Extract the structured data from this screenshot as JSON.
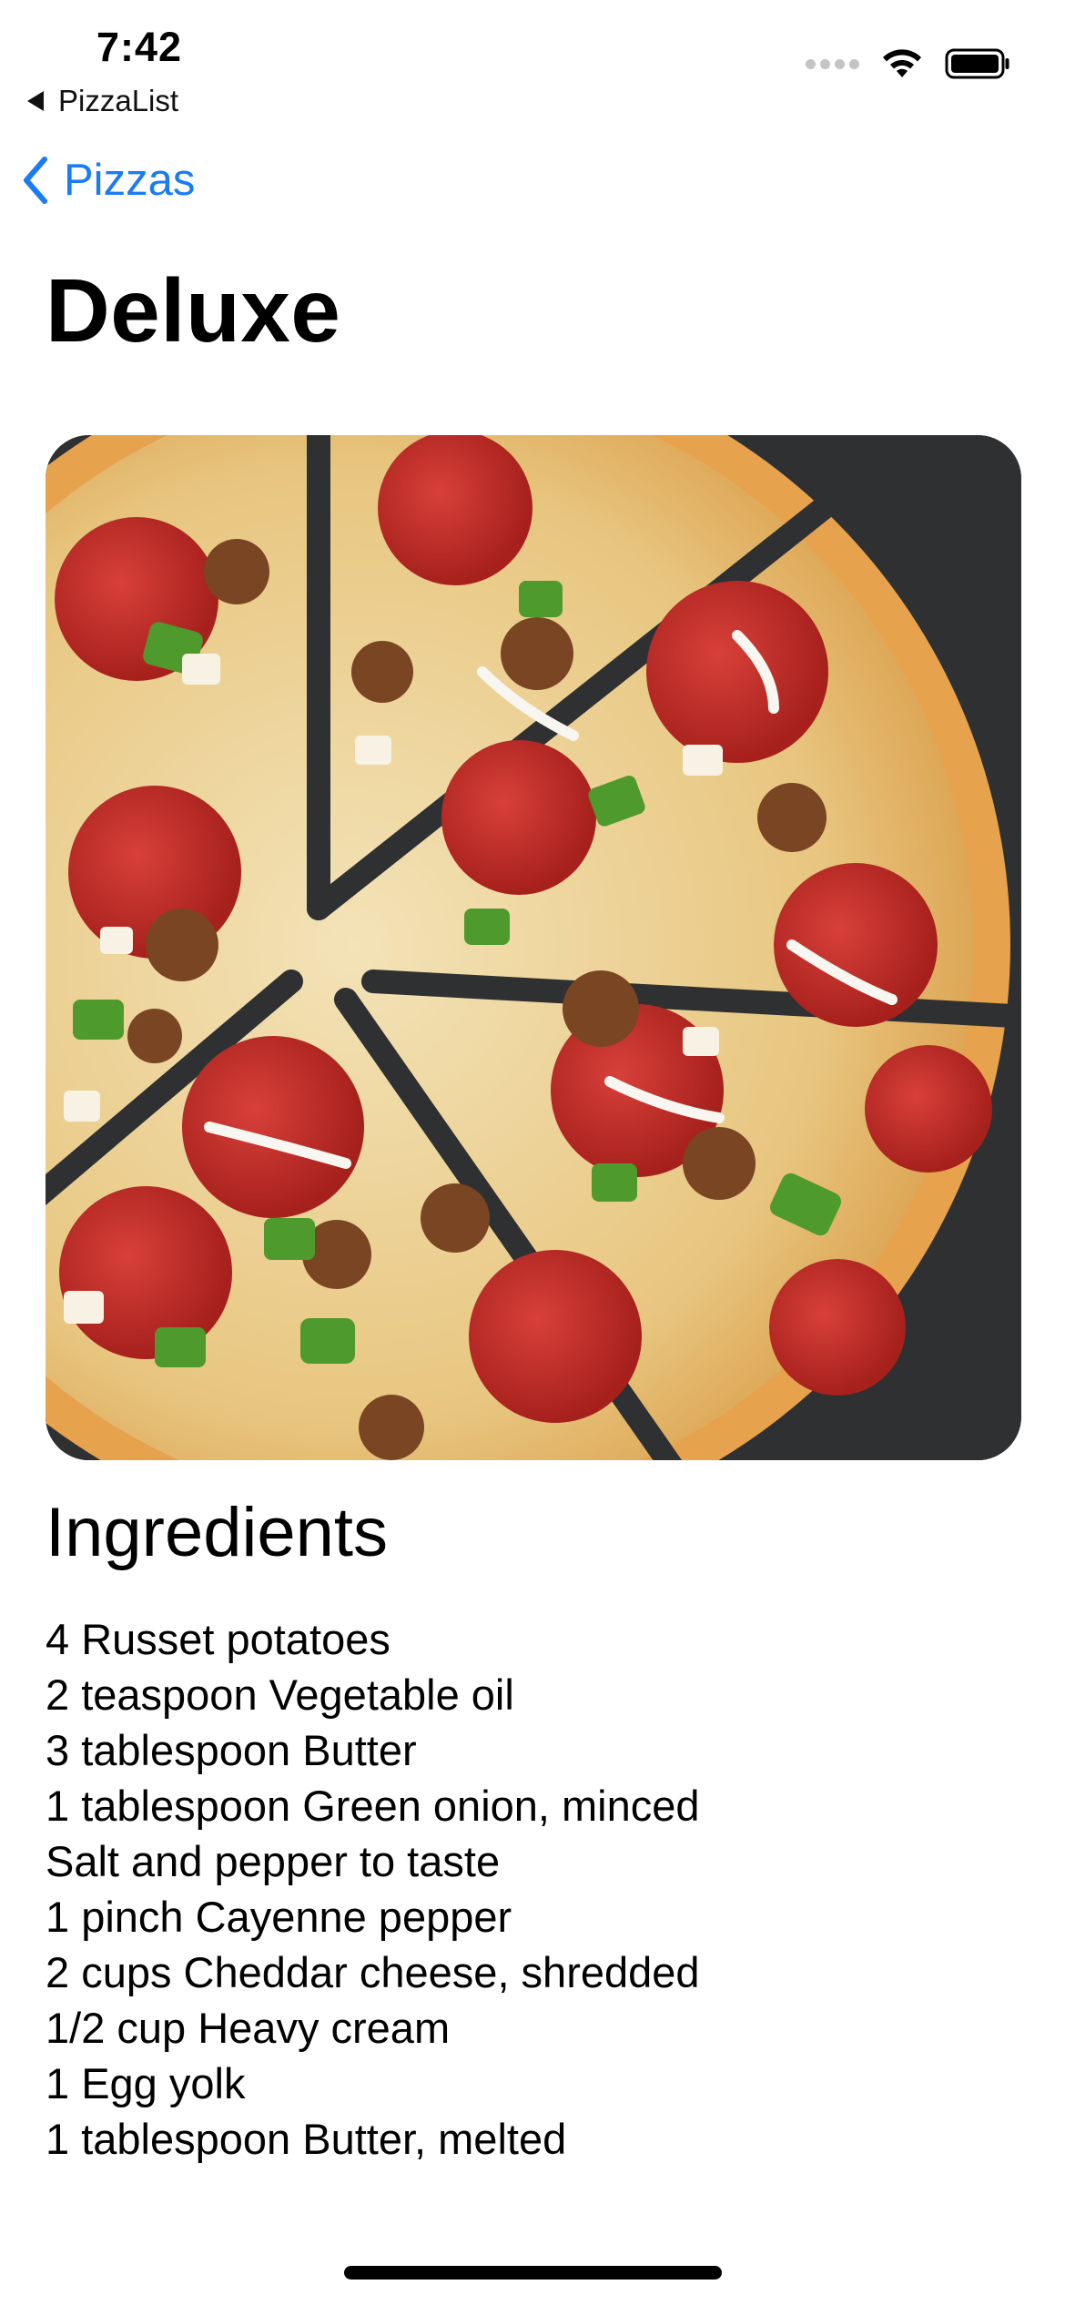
{
  "status_bar": {
    "time": "7:42",
    "back_app": "PizzaList"
  },
  "nav": {
    "back_label": "Pizzas"
  },
  "pizza": {
    "name": "Deluxe",
    "image_alt": "Deluxe pizza"
  },
  "ingredients": {
    "heading": "Ingredients",
    "items": [
      "4 Russet potatoes",
      "2 teaspoon Vegetable oil",
      "3 tablespoon Butter",
      "1 tablespoon Green onion, minced",
      "Salt and pepper to taste",
      "1 pinch Cayenne pepper",
      "2 cups Cheddar cheese, shredded",
      "1/2 cup Heavy cream",
      "1 Egg yolk",
      "1 tablespoon Butter, melted"
    ]
  },
  "colors": {
    "accent": "#1a7cf4",
    "text": "#000000",
    "background": "#ffffff"
  },
  "icons": {
    "cellular": "cellular-signal-icon",
    "wifi": "wifi-icon",
    "battery": "battery-icon",
    "back": "chevron-left-icon"
  }
}
